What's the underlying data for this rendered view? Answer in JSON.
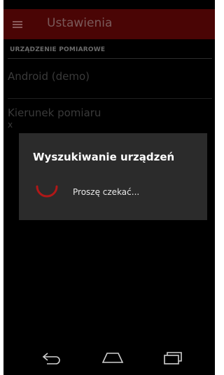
{
  "appbar": {
    "title": "Ustawienia",
    "menu_icon": "hamburger-menu-icon"
  },
  "settings": {
    "section_header": "URZĄDZENIE POMIAROWE",
    "device": "Android (demo)",
    "axis_title": "Kierunek pomiaru",
    "axis_value": "x"
  },
  "dialog": {
    "title": "Wyszukiwanie urządzeń",
    "message": "Proszę czekać...",
    "spinner_color": "#b01818"
  },
  "navbar": {
    "back_icon": "back-icon",
    "home_icon": "home-icon",
    "recents_icon": "recents-icon"
  },
  "colors": {
    "appbar": "#4a0505",
    "accent": "#b01818",
    "dialog": "#2b2b2b"
  }
}
